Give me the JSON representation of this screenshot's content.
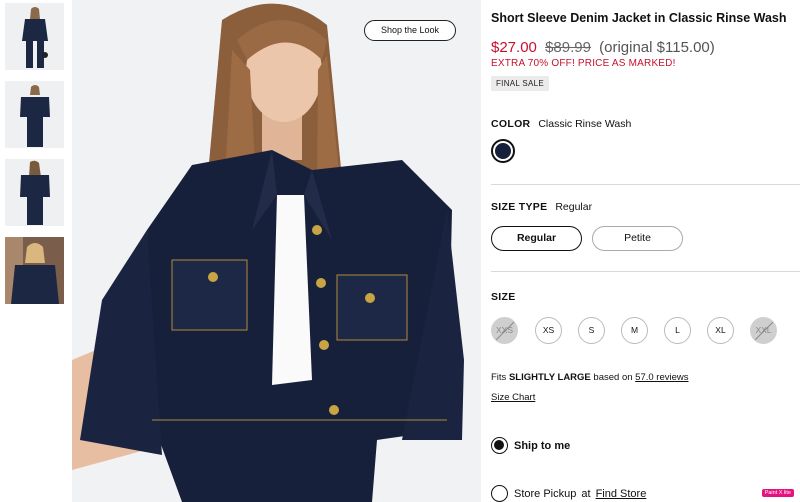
{
  "product": {
    "title": "Short Sleeve Denim Jacket in Classic Rinse Wash",
    "price_sale": "$27.00",
    "price_was": "$89.99",
    "price_original": "(original $115.00)",
    "promo": "EXTRA 70% OFF! PRICE AS MARKED!",
    "final_sale": "FINAL SALE"
  },
  "gallery": {
    "shop_the_look": "Shop the Look",
    "thumbnail_count": 4,
    "active_index": 0
  },
  "color": {
    "label": "COLOR",
    "value": "Classic Rinse Wash",
    "swatch_hex": "#17203a"
  },
  "size_type": {
    "label": "SIZE TYPE",
    "value": "Regular",
    "options": [
      "Regular",
      "Petite"
    ]
  },
  "size": {
    "label": "SIZE",
    "options": [
      {
        "label": "XXS",
        "available": false
      },
      {
        "label": "XS",
        "available": true
      },
      {
        "label": "S",
        "available": true
      },
      {
        "label": "M",
        "available": true
      },
      {
        "label": "L",
        "available": true
      },
      {
        "label": "XL",
        "available": true
      },
      {
        "label": "XXL",
        "available": false
      }
    ]
  },
  "fit": {
    "prefix": "Fits",
    "value": "SLIGHTLY LARGE",
    "middle": "based on",
    "reviews_link": "57.0 reviews"
  },
  "size_chart": "Size Chart",
  "delivery": {
    "ship_label": "Ship to me",
    "pickup_label": "Store Pickup",
    "pickup_at": "at",
    "find_store": "Find Store"
  },
  "extension_badge": "Paint X lite",
  "colors": {
    "sale_red": "#c8102e",
    "denim": "#17203a"
  }
}
